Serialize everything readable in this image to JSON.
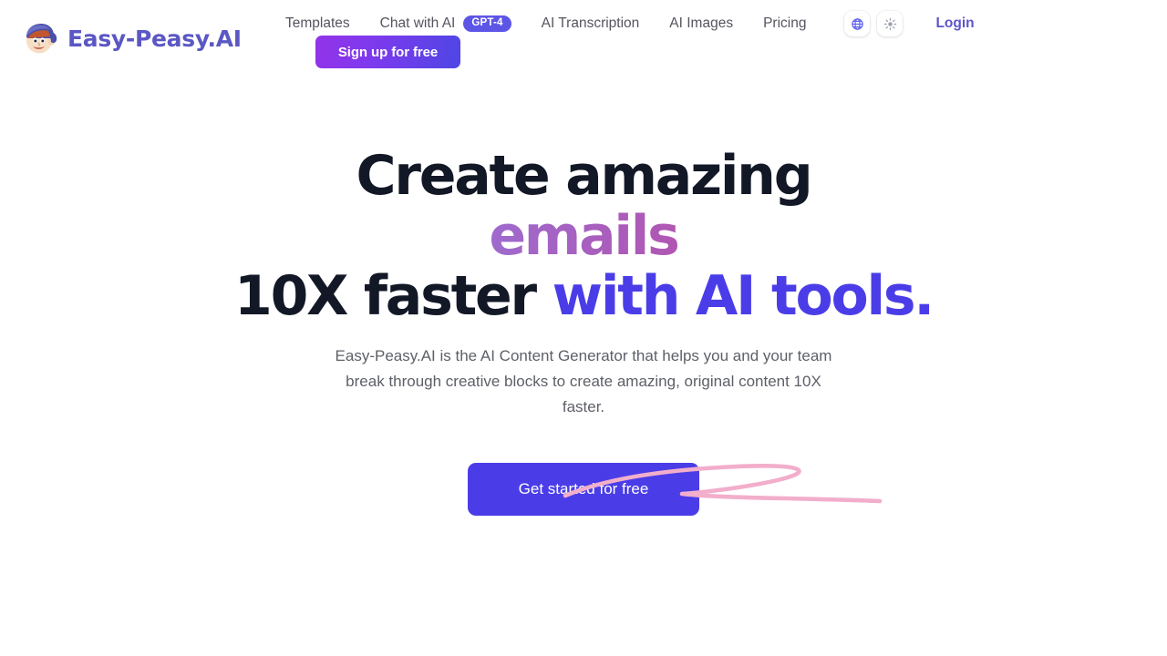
{
  "brand": {
    "name": "Easy-Peasy.AI",
    "mascot_icon": "mascot-face-cap-icon",
    "logo_color": "#5b57c4"
  },
  "nav": {
    "items": [
      {
        "label": "Templates",
        "name": "templates"
      },
      {
        "label": "Chat with AI",
        "name": "chat-with-ai",
        "badge": "GPT-4"
      },
      {
        "label": "AI Transcription",
        "name": "ai-transcription"
      },
      {
        "label": "AI Images",
        "name": "ai-images"
      },
      {
        "label": "Pricing",
        "name": "pricing"
      }
    ],
    "badge_label": "GPT-4",
    "badge_color": "#5d55e6",
    "language_icon": "globe-icon",
    "language_icon_color": "#6366f1",
    "theme_icon": "sun-icon",
    "theme_icon_color": "#9ca0ad",
    "login_label": "Login",
    "login_color": "#5f55c9",
    "signup_label": "Sign up for free",
    "signup_gradient_from": "#9333ea",
    "signup_gradient_to": "#4f46e5"
  },
  "hero": {
    "headline_line1": "Create amazing",
    "headline_line2": "emails",
    "headline_line3_plain": "10X faster ",
    "headline_line3_accent": "with AI tools.",
    "headline_color": "#131827",
    "accent_color": "#4a3de8",
    "gradient_from": "#7b82e8",
    "gradient_mid": "#9a6fd4",
    "gradient_to": "#dd2a78",
    "underline_color": "#f2aecb",
    "subtitle": "Easy-Peasy.AI is the AI Content Generator that helps you and your team break through creative blocks to create amazing, original content 10X faster.",
    "cta_label": "Get started for free",
    "cta_color": "#4a3de8"
  }
}
